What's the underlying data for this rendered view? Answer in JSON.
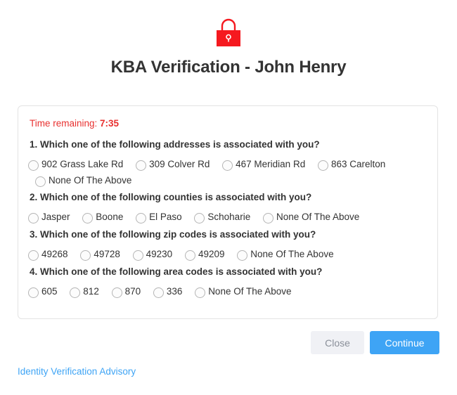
{
  "header": {
    "icon": "lock-icon",
    "title": "KBA Verification - John Henry",
    "accent_color": "#f5191f"
  },
  "timer": {
    "label": "Time remaining:",
    "value": "7:35",
    "color": "#e8302f"
  },
  "questions": [
    {
      "text": "1. Which one of the following addresses is associated with you?",
      "options": [
        "902 Grass Lake Rd",
        "309 Colver Rd",
        "467 Meridian Rd",
        "863 Carelton",
        "None Of The Above"
      ]
    },
    {
      "text": "2. Which one of the following counties is associated with you?",
      "options": [
        "Jasper",
        "Boone",
        "El Paso",
        "Schoharie",
        "None Of The Above"
      ]
    },
    {
      "text": "3. Which one of the following zip codes is associated with you?",
      "options": [
        "49268",
        "49728",
        "49230",
        "49209",
        "None Of The Above"
      ]
    },
    {
      "text": "4. Which one of the following area codes is associated with you?",
      "options": [
        "605",
        "812",
        "870",
        "336",
        "None Of The Above"
      ]
    }
  ],
  "actions": {
    "close_label": "Close",
    "continue_label": "Continue",
    "continue_color": "#3ea4f5"
  },
  "footer": {
    "advisory_link": "Identity Verification Advisory"
  }
}
